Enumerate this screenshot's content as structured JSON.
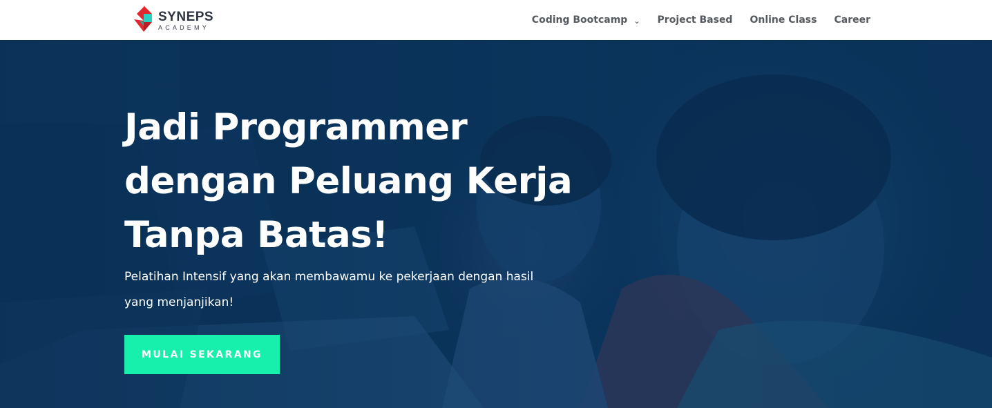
{
  "brand": {
    "name": "SYNEPS",
    "sub": "ACADEMY",
    "colors": {
      "red": "#e3262f",
      "teal": "#2ad0c2",
      "dark": "#2d3340"
    }
  },
  "nav": {
    "items": [
      {
        "label": "Coding Bootcamp",
        "icon": "chevron-down-icon"
      },
      {
        "label": "Project Based"
      },
      {
        "label": "Online Class"
      },
      {
        "label": "Career"
      }
    ]
  },
  "hero": {
    "title_lines": [
      "Jadi Programmer",
      "dengan Peluang Kerja",
      "Tanpa Batas!"
    ],
    "subtitle": "Pelatihan Intensif yang akan membawamu ke pekerjaan dengan hasil yang menjanjikan!",
    "cta_label": "MULAI SEKARANG",
    "overlay_color": "#0d3a63",
    "cta_color": "#17f0ad"
  }
}
